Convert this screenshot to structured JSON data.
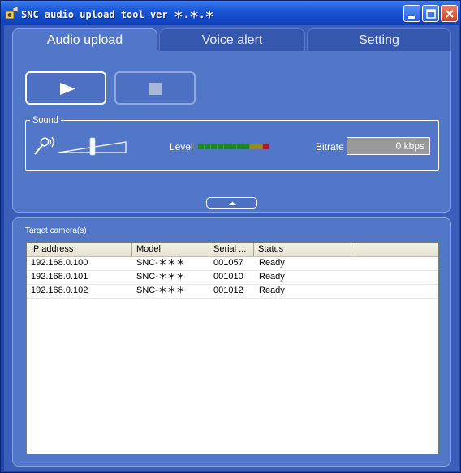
{
  "window": {
    "title": "SNC audio upload tool ver",
    "version": "＊.＊.＊"
  },
  "tabs": [
    {
      "label": "Audio upload",
      "active": true
    },
    {
      "label": "Voice alert",
      "active": false
    },
    {
      "label": "Setting",
      "active": false
    }
  ],
  "controls": {
    "play_icon": "play-icon",
    "stop_icon": "stop-icon"
  },
  "sound": {
    "legend": "Sound",
    "level_label": "Level",
    "level_segments": [
      "#1e8a1e",
      "#1e8a1e",
      "#1e8a1e",
      "#1e8a1e",
      "#1e8a1e",
      "#1e8a1e",
      "#1e8a1e",
      "#1e8a1e",
      "#9a8a1e",
      "#9a8a1e",
      "#c01818"
    ],
    "bitrate_label": "Bitrate",
    "bitrate_value": "0 kbps",
    "volume_level": 0.5
  },
  "targets": {
    "label": "Target camera(s)",
    "columns": [
      "IP address",
      "Model",
      "Serial ...",
      "Status"
    ],
    "rows": [
      {
        "ip": "192.168.0.100",
        "model": "SNC-＊＊＊",
        "serial": "001057",
        "status": "Ready"
      },
      {
        "ip": "192.168.0.101",
        "model": "SNC-＊＊＊",
        "serial": "001010",
        "status": "Ready"
      },
      {
        "ip": "192.168.0.102",
        "model": "SNC-＊＊＊",
        "serial": "001012",
        "status": "Ready"
      }
    ]
  },
  "colors": {
    "accent": "#5377c8",
    "titlebar": "#1a56d6"
  }
}
